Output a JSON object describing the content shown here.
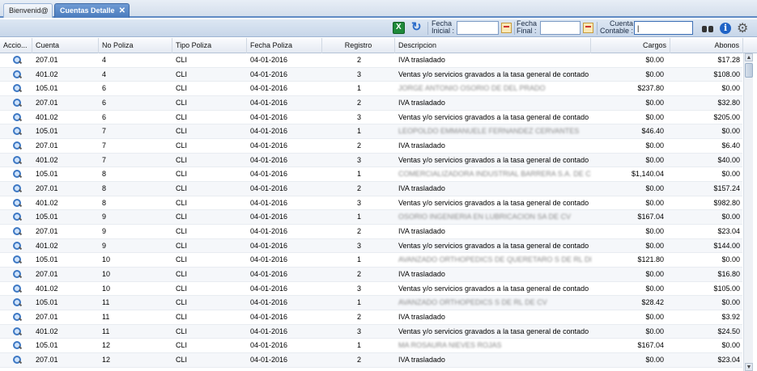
{
  "tabs": [
    {
      "label": "Bienvenid@"
    },
    {
      "label": "Cuentas Detalle",
      "close": "✕"
    }
  ],
  "toolbar": {
    "fecha_inicial_label": "Fecha Inicial :",
    "fecha_inicial_value": "",
    "fecha_final_label": "Fecha Final :",
    "fecha_final_value": "",
    "cuenta_contable_label": "Cuenta Contable :",
    "cuenta_contable_value": "|"
  },
  "grid": {
    "columns": [
      "Accio...",
      "Cuenta",
      "No Poliza",
      "Tipo Poliza",
      "Fecha Poliza",
      "Registro",
      "Descripcion",
      "Cargos",
      "Abonos"
    ],
    "rows": [
      {
        "cuenta": "207.01",
        "no_poliza": "4",
        "tipo": "CLI",
        "fecha": "04-01-2016",
        "registro": "2",
        "descripcion": "IVA trasladado",
        "blur": false,
        "cargos": "$0.00",
        "abonos": "$17.28"
      },
      {
        "cuenta": "401.02",
        "no_poliza": "4",
        "tipo": "CLI",
        "fecha": "04-01-2016",
        "registro": "3",
        "descripcion": "Ventas y/o servicios gravados a la tasa general de contado",
        "blur": false,
        "cargos": "$0.00",
        "abonos": "$108.00"
      },
      {
        "cuenta": "105.01",
        "no_poliza": "6",
        "tipo": "CLI",
        "fecha": "04-01-2016",
        "registro": "1",
        "descripcion": "JORGE ANTONIO OSORIO DE DEL PRADO",
        "blur": true,
        "cargos": "$237.80",
        "abonos": "$0.00"
      },
      {
        "cuenta": "207.01",
        "no_poliza": "6",
        "tipo": "CLI",
        "fecha": "04-01-2016",
        "registro": "2",
        "descripcion": "IVA trasladado",
        "blur": false,
        "cargos": "$0.00",
        "abonos": "$32.80"
      },
      {
        "cuenta": "401.02",
        "no_poliza": "6",
        "tipo": "CLI",
        "fecha": "04-01-2016",
        "registro": "3",
        "descripcion": "Ventas y/o servicios gravados a la tasa general de contado",
        "blur": false,
        "cargos": "$0.00",
        "abonos": "$205.00"
      },
      {
        "cuenta": "105.01",
        "no_poliza": "7",
        "tipo": "CLI",
        "fecha": "04-01-2016",
        "registro": "1",
        "descripcion": "LEOPOLDO EMMANUELE FERNANDEZ CERVANTES",
        "blur": true,
        "cargos": "$46.40",
        "abonos": "$0.00"
      },
      {
        "cuenta": "207.01",
        "no_poliza": "7",
        "tipo": "CLI",
        "fecha": "04-01-2016",
        "registro": "2",
        "descripcion": "IVA trasladado",
        "blur": false,
        "cargos": "$0.00",
        "abonos": "$6.40"
      },
      {
        "cuenta": "401.02",
        "no_poliza": "7",
        "tipo": "CLI",
        "fecha": "04-01-2016",
        "registro": "3",
        "descripcion": "Ventas y/o servicios gravados a la tasa general de contado",
        "blur": false,
        "cargos": "$0.00",
        "abonos": "$40.00"
      },
      {
        "cuenta": "105.01",
        "no_poliza": "8",
        "tipo": "CLI",
        "fecha": "04-01-2016",
        "registro": "1",
        "descripcion": "COMERCIALIZADORA INDUSTRIAL BARRERA S.A. DE C.V.",
        "blur": true,
        "cargos": "$1,140.04",
        "abonos": "$0.00"
      },
      {
        "cuenta": "207.01",
        "no_poliza": "8",
        "tipo": "CLI",
        "fecha": "04-01-2016",
        "registro": "2",
        "descripcion": "IVA trasladado",
        "blur": false,
        "cargos": "$0.00",
        "abonos": "$157.24"
      },
      {
        "cuenta": "401.02",
        "no_poliza": "8",
        "tipo": "CLI",
        "fecha": "04-01-2016",
        "registro": "3",
        "descripcion": "Ventas y/o servicios gravados a la tasa general de contado",
        "blur": false,
        "cargos": "$0.00",
        "abonos": "$982.80"
      },
      {
        "cuenta": "105.01",
        "no_poliza": "9",
        "tipo": "CLI",
        "fecha": "04-01-2016",
        "registro": "1",
        "descripcion": "OSORIO INGENIERIA EN LUBRICACION SA DE CV",
        "blur": true,
        "cargos": "$167.04",
        "abonos": "$0.00"
      },
      {
        "cuenta": "207.01",
        "no_poliza": "9",
        "tipo": "CLI",
        "fecha": "04-01-2016",
        "registro": "2",
        "descripcion": "IVA trasladado",
        "blur": false,
        "cargos": "$0.00",
        "abonos": "$23.04"
      },
      {
        "cuenta": "401.02",
        "no_poliza": "9",
        "tipo": "CLI",
        "fecha": "04-01-2016",
        "registro": "3",
        "descripcion": "Ventas y/o servicios gravados a la tasa general de contado",
        "blur": false,
        "cargos": "$0.00",
        "abonos": "$144.00"
      },
      {
        "cuenta": "105.01",
        "no_poliza": "10",
        "tipo": "CLI",
        "fecha": "04-01-2016",
        "registro": "1",
        "descripcion": "AVANZADO ORTHOPEDICS DE QUERETARO S DE RL DE CV",
        "blur": true,
        "cargos": "$121.80",
        "abonos": "$0.00"
      },
      {
        "cuenta": "207.01",
        "no_poliza": "10",
        "tipo": "CLI",
        "fecha": "04-01-2016",
        "registro": "2",
        "descripcion": "IVA trasladado",
        "blur": false,
        "cargos": "$0.00",
        "abonos": "$16.80"
      },
      {
        "cuenta": "401.02",
        "no_poliza": "10",
        "tipo": "CLI",
        "fecha": "04-01-2016",
        "registro": "3",
        "descripcion": "Ventas y/o servicios gravados a la tasa general de contado",
        "blur": false,
        "cargos": "$0.00",
        "abonos": "$105.00"
      },
      {
        "cuenta": "105.01",
        "no_poliza": "11",
        "tipo": "CLI",
        "fecha": "04-01-2016",
        "registro": "1",
        "descripcion": "AVANZADO ORTHOPEDICS S DE RL DE CV",
        "blur": true,
        "cargos": "$28.42",
        "abonos": "$0.00"
      },
      {
        "cuenta": "207.01",
        "no_poliza": "11",
        "tipo": "CLI",
        "fecha": "04-01-2016",
        "registro": "2",
        "descripcion": "IVA trasladado",
        "blur": false,
        "cargos": "$0.00",
        "abonos": "$3.92"
      },
      {
        "cuenta": "401.02",
        "no_poliza": "11",
        "tipo": "CLI",
        "fecha": "04-01-2016",
        "registro": "3",
        "descripcion": "Ventas y/o servicios gravados a la tasa general de contado",
        "blur": false,
        "cargos": "$0.00",
        "abonos": "$24.50"
      },
      {
        "cuenta": "105.01",
        "no_poliza": "12",
        "tipo": "CLI",
        "fecha": "04-01-2016",
        "registro": "1",
        "descripcion": "MA ROSAURA NIEVES ROJAS",
        "blur": true,
        "cargos": "$167.04",
        "abonos": "$0.00"
      },
      {
        "cuenta": "207.01",
        "no_poliza": "12",
        "tipo": "CLI",
        "fecha": "04-01-2016",
        "registro": "2",
        "descripcion": "IVA trasladado",
        "blur": false,
        "cargos": "$0.00",
        "abonos": "$23.04"
      }
    ]
  },
  "scrollbar": {
    "up": "▲",
    "down": "▼"
  }
}
